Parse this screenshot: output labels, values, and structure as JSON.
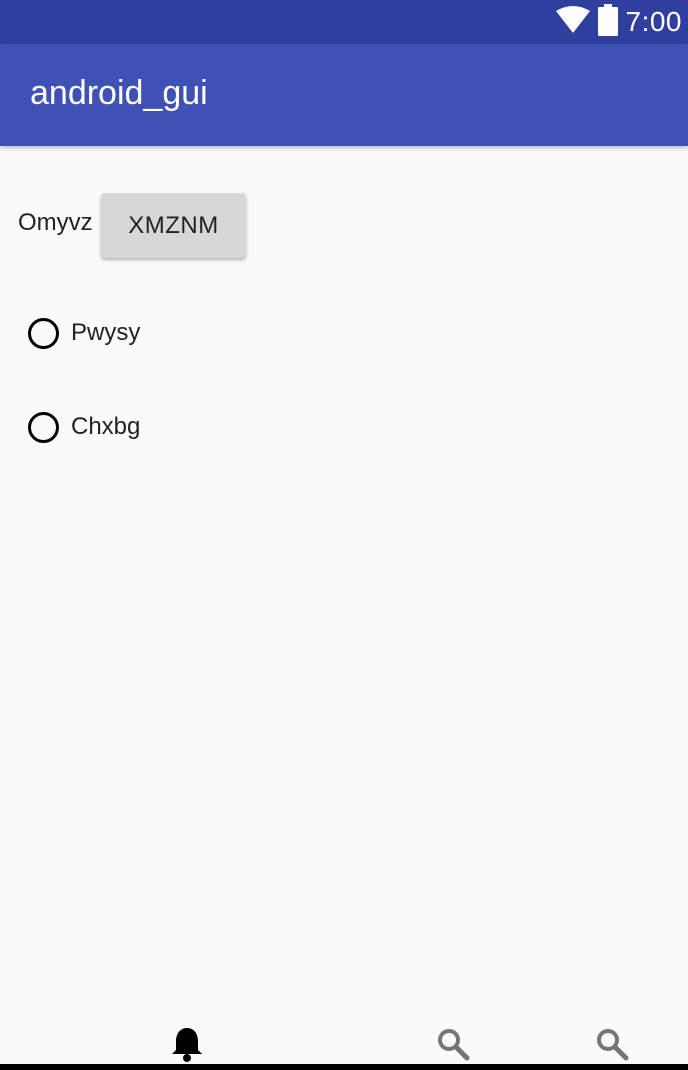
{
  "status_bar": {
    "time": "7:00",
    "icons": [
      "wifi-icon",
      "battery-icon"
    ],
    "background": "#303f9f"
  },
  "app_bar": {
    "title": "android_gui",
    "background": "#3f51b5"
  },
  "main": {
    "label": "Omyvz",
    "button_label": "XMZNM",
    "radios": [
      {
        "label": "Pwysy",
        "checked": false
      },
      {
        "label": "Chxbg",
        "checked": false
      }
    ]
  },
  "bottom_nav": {
    "items": [
      {
        "icon": "bell-icon",
        "selected": true
      },
      {
        "icon": "search-icon",
        "selected": false
      },
      {
        "icon": "search-icon",
        "selected": false
      }
    ]
  }
}
